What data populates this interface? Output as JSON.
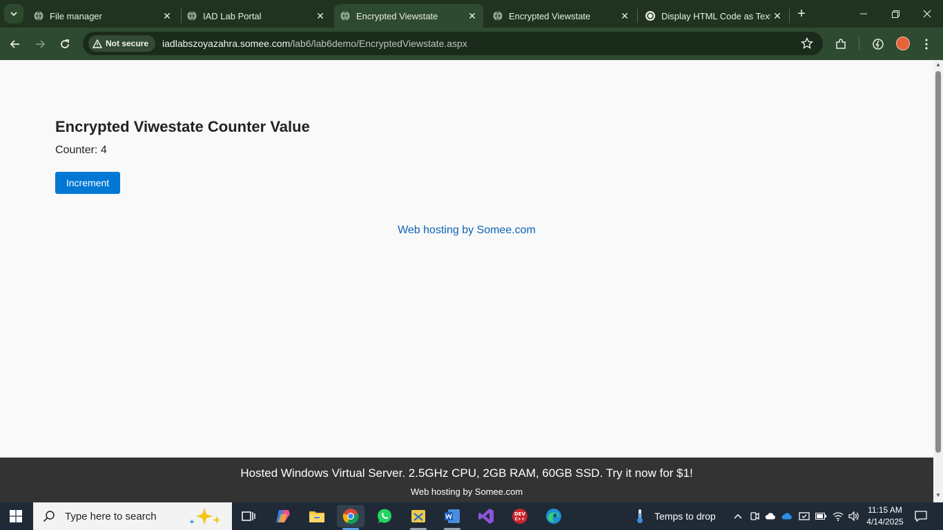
{
  "browser": {
    "tabs": [
      {
        "title": "File manager",
        "active": false
      },
      {
        "title": "IAD Lab Portal",
        "active": false
      },
      {
        "title": "Encrypted Viewstate",
        "active": true
      },
      {
        "title": "Encrypted Viewstate",
        "active": false
      },
      {
        "title": "Display HTML Code as Text",
        "active": false
      }
    ],
    "security_label": "Not secure",
    "url_host": "iadlabszoyazahra.somee.com",
    "url_path": "/lab6/lab6demo/EncryptedViewstate.aspx"
  },
  "page": {
    "title": "Encrypted Viwestate Counter Value",
    "counter_text": "Counter: 4",
    "increment_label": "Increment",
    "hosting_link": "Web hosting by Somee.com",
    "banner_text": "Hosted Windows Virtual Server. 2.5GHz CPU, 2GB RAM, 60GB SSD. Try it now for $1!",
    "banner_link": "Web hosting by Somee.com"
  },
  "taskbar": {
    "search_placeholder": "Type here to search",
    "weather": "Temps to drop",
    "time": "11:15 AM",
    "date": "4/14/2025"
  },
  "colors": {
    "chrome_dark": "#1f3320",
    "chrome_toolbar": "#2e4a30",
    "button_blue": "#0078d4",
    "link_blue": "#0b63b6",
    "banner_bg": "#333333",
    "taskbar_bg": "#1f2a36"
  }
}
